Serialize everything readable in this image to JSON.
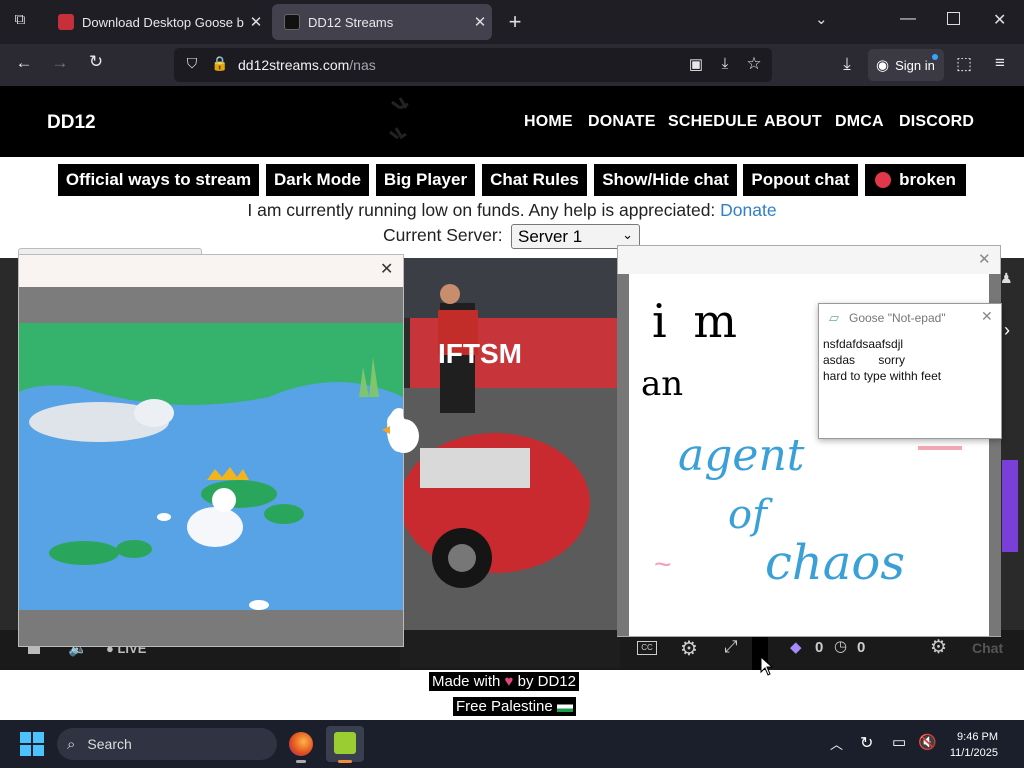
{
  "browser": {
    "tabs": [
      {
        "title": "Download Desktop Goose by sa",
        "active": false
      },
      {
        "title": "DD12 Streams",
        "active": true
      }
    ],
    "url_domain": "dd12streams.com",
    "url_path": "/nas",
    "signin_label": "Sign in"
  },
  "site": {
    "logo": "DD12",
    "nav": [
      "HOME",
      "DONATE",
      "SCHEDULE",
      "ABOUT",
      "DMCA",
      "DISCORD"
    ],
    "buttons": [
      "Official ways to stream",
      "Dark Mode",
      "Big Player",
      "Chat Rules",
      "Show/Hide chat",
      "Popout chat",
      "broken"
    ],
    "funds_text": "I am currently running low on funds. Any help is appreciated:",
    "donate_link": "Donate",
    "server_label": "Current Server:",
    "server_value": "Server 1"
  },
  "player": {
    "live_label": "LIVE",
    "chat_label": "Chat",
    "viewer_count_a": "0",
    "viewer_count_b": "0",
    "banner_text": "IFTSM"
  },
  "goose_notepad": {
    "title": "Goose \"Not-epad\"",
    "lines": [
      "nsfdafdsaafsdjl",
      "asdas       sorry",
      "hard to type withh feet"
    ]
  },
  "paint_text": {
    "line1": "i  m",
    "line2": "an",
    "line3": "agent",
    "line4": "of",
    "line5": "chaos"
  },
  "footer": {
    "made_prefix": "Made with",
    "made_suffix": "by DD12",
    "free": "Free Palestine"
  },
  "taskbar": {
    "search_placeholder": "Search",
    "time": "9:46 PM",
    "date": "11/1/2025"
  },
  "colors": {
    "browser_bg": "#1f1e25",
    "site_header": "#000000",
    "donate_link": "#2f80c8",
    "pond_water": "#58a3e5",
    "grass": "#35b26c",
    "chaos_blue": "#3aa0d8"
  }
}
